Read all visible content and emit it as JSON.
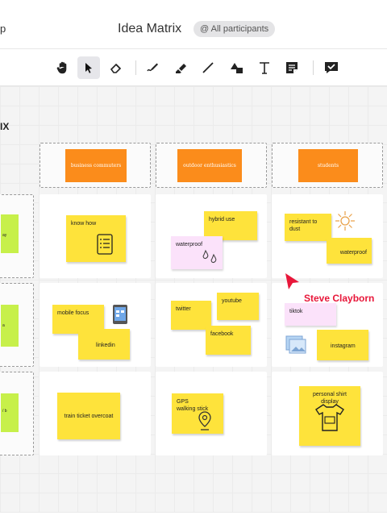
{
  "header": {
    "left_text": "p",
    "title": "Idea Matrix",
    "badge": "@ All participants"
  },
  "toolbar": {
    "tools": [
      {
        "name": "hand-tool",
        "icon": "hand-icon"
      },
      {
        "name": "select-tool",
        "icon": "pointer-icon",
        "active": true
      },
      {
        "name": "eraser-tool",
        "icon": "eraser-icon"
      },
      {
        "name": "pen-tool",
        "icon": "pen-icon"
      },
      {
        "name": "highlighter-tool",
        "icon": "highlighter-icon"
      },
      {
        "name": "line-tool",
        "icon": "line-icon"
      },
      {
        "name": "shapes-tool",
        "icon": "shapes-icon"
      },
      {
        "name": "text-tool",
        "icon": "text-icon"
      },
      {
        "name": "sticky-note-tool",
        "icon": "sticky-note-icon"
      },
      {
        "name": "feedback-tool",
        "icon": "feedback-icon"
      }
    ]
  },
  "board": {
    "matrix_title": "IX",
    "columns": [
      "business commuters",
      "outdoor enthusiastics",
      "students"
    ],
    "rows": [
      {
        "row_label": "ay",
        "cells": [
          {
            "notes": [
              "know how"
            ]
          },
          {
            "notes": [
              "hybrid use",
              "waterproof"
            ]
          },
          {
            "notes": [
              "resistant to dust",
              "waterproof"
            ]
          }
        ]
      },
      {
        "row_label": "a",
        "cells": [
          {
            "notes": [
              "mobile focus",
              "linkedin"
            ]
          },
          {
            "notes": [
              "youtube",
              "twitter",
              "facebook"
            ]
          },
          {
            "notes": [
              "tiktok",
              "instagram"
            ]
          }
        ]
      },
      {
        "row_label": "/ b",
        "cells": [
          {
            "notes": [
              "train ticket overcoat"
            ]
          },
          {
            "notes": [
              "GPS walking stick"
            ]
          },
          {
            "notes": [
              "personal shirt display"
            ]
          }
        ]
      }
    ],
    "cursor": {
      "user": "Steve Clayborn",
      "color": "#e8173a"
    }
  },
  "colors": {
    "sticky_yellow": "#fee33b",
    "sticky_pink": "#fbe2fa",
    "sticky_green": "#c7f04a",
    "header_orange": "#fb8c1b",
    "cursor_red": "#e8173a"
  }
}
